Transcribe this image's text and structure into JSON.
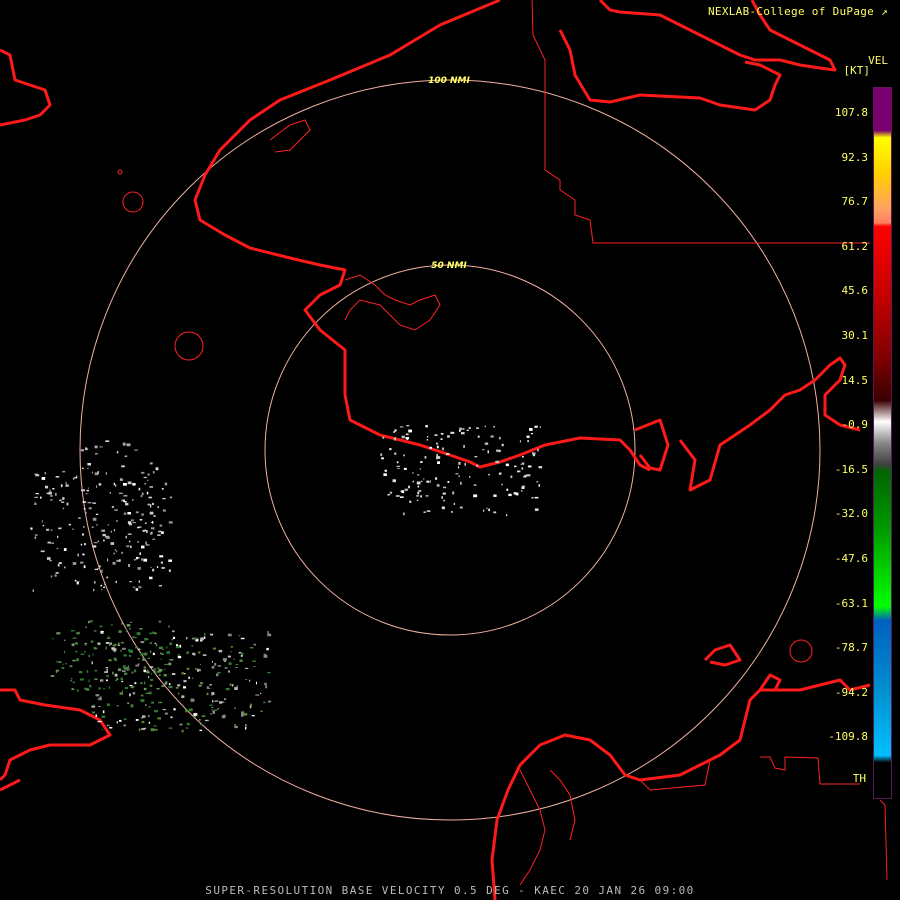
{
  "credit": "NEXLAB-College of DuPage",
  "legend": {
    "title": "VEL",
    "unit": "[KT]",
    "ticks": [
      "107.8",
      "92.3",
      "76.7",
      "61.2",
      "45.6",
      "30.1",
      "14.5",
      "-0.9",
      "-16.5",
      "-32.0",
      "-47.6",
      "-63.1",
      "-78.7",
      "-94.2",
      "-109.8",
      "TH"
    ],
    "colors": [
      "#7a0070",
      "#ffff00",
      "#ffa060",
      "#ff0000",
      "#b00000",
      "#600000",
      "#3a0000",
      "#ffffff",
      "#006600",
      "#00ff00",
      "#0060c0",
      "#00c0ff",
      "#000000"
    ]
  },
  "range_rings": {
    "inner_label": "50 NMI",
    "outer_label": "100 NMI"
  },
  "footer": "SUPER-RESOLUTION BASE VELOCITY 0.5 DEG - KAEC 20 JAN 26 09:00",
  "colors": {
    "coast": "#ff1a1a",
    "ring": "#f0b0a0",
    "label": "#ffff66"
  }
}
